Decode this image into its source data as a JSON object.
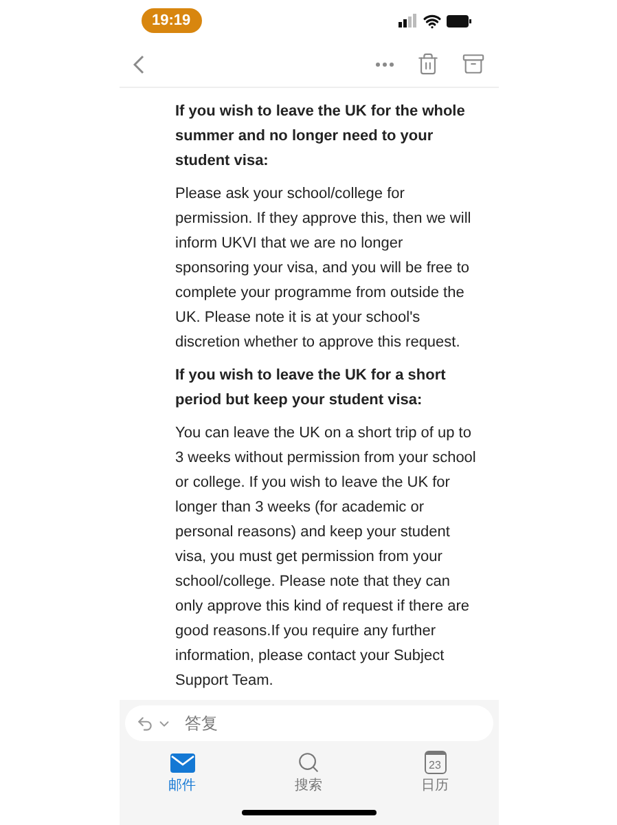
{
  "status_bar": {
    "time": "19:19"
  },
  "sections": [
    {
      "heading": "If you wish to leave the UK for the whole summer and no longer need to your student visa:",
      "body": "Please ask your school/college for permission. If they approve this, then we will inform UKVI that we are no longer sponsoring your visa, and you will be free to complete your programme from outside the UK. Please note it is at your school's discretion whether to approve this request."
    },
    {
      "heading": "If you wish to leave the UK for a short period but keep your student visa:",
      "body": "You can leave the UK on a short trip of up to 3 weeks without permission from your school or college. If you wish to leave the UK for longer than 3 weeks (for academic or personal reasons) and keep your student visa, you must get permission from your school/college. Please note that they can only approve this kind of request if there are good reasons.If you require any further information, please contact your Subject Support Team."
    }
  ],
  "reply": {
    "placeholder": "答复"
  },
  "tabs": [
    {
      "kind": "mail",
      "label": "邮件",
      "selected": true
    },
    {
      "kind": "search",
      "label": "搜索",
      "selected": false
    },
    {
      "kind": "calendar",
      "label": "日历",
      "selected": false,
      "day": "23"
    }
  ]
}
